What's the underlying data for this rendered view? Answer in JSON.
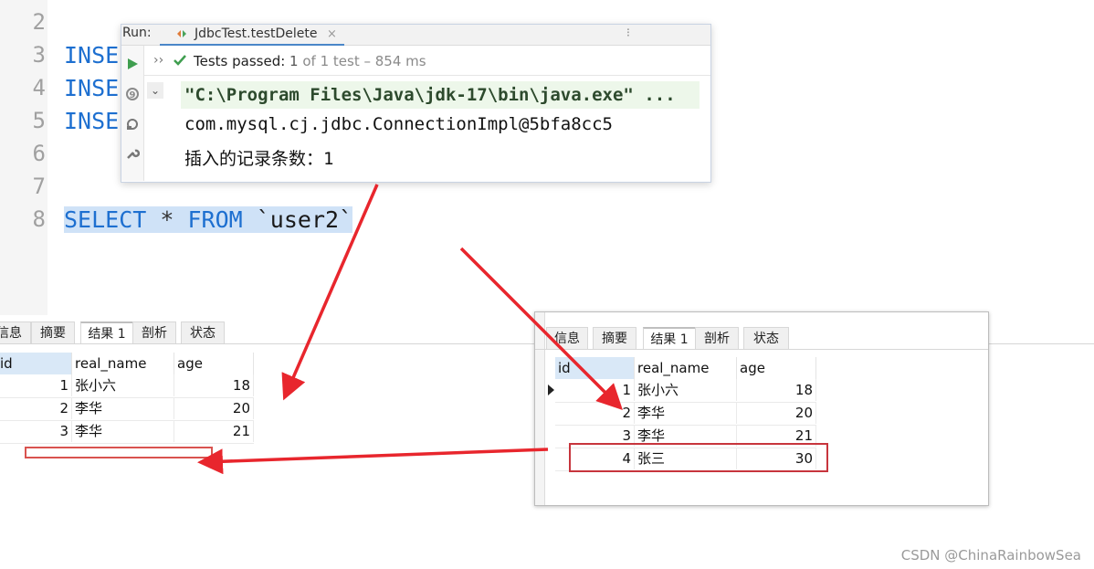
{
  "editor": {
    "line_numbers": [
      "2",
      "3",
      "4",
      "5",
      "6",
      "7",
      "8"
    ],
    "code_lines": {
      "l3": "INSE",
      "l4": "INSE",
      "l5": "INSE",
      "l8_keyword1": "SELECT",
      "l8_star": " * ",
      "l8_keyword2": "FROM",
      "l8_table": " `user2`"
    }
  },
  "run": {
    "label": "Run:",
    "tab_title": "JdbcTest.testDelete",
    "tab_close": "×",
    "more": "⁝",
    "chevrons": "››",
    "status_passed": "Tests passed: ",
    "status_count": "1 ",
    "status_detail": "of 1 test – 854 ms",
    "console_lines": [
      "\"C:\\Program Files\\Java\\jdk-17\\bin\\java.exe\" ...",
      "com.mysql.cj.jdbc.ConnectionImpl@5bfa8cc5",
      "插入的记录条数：1"
    ]
  },
  "left_panel": {
    "tabs": [
      "信息",
      "摘要",
      "结果 1",
      "剖析",
      "状态"
    ],
    "columns": [
      "id",
      "real_name",
      "age"
    ],
    "rows": [
      {
        "id": "1",
        "real_name": "张小六",
        "age": "18"
      },
      {
        "id": "2",
        "real_name": "李华",
        "age": "20"
      },
      {
        "id": "3",
        "real_name": "李华",
        "age": "21"
      }
    ]
  },
  "right_panel": {
    "tabs": [
      "信息",
      "摘要",
      "结果 1",
      "剖析",
      "状态"
    ],
    "columns": [
      "id",
      "real_name",
      "age"
    ],
    "rows": [
      {
        "id": "1",
        "real_name": "张小六",
        "age": "18"
      },
      {
        "id": "2",
        "real_name": "李华",
        "age": "20"
      },
      {
        "id": "3",
        "real_name": "李华",
        "age": "21"
      },
      {
        "id": "4",
        "real_name": "张三",
        "age": "30"
      }
    ]
  },
  "annotation_color": "#e8262d",
  "watermark": "CSDN @ChinaRainbowSea"
}
